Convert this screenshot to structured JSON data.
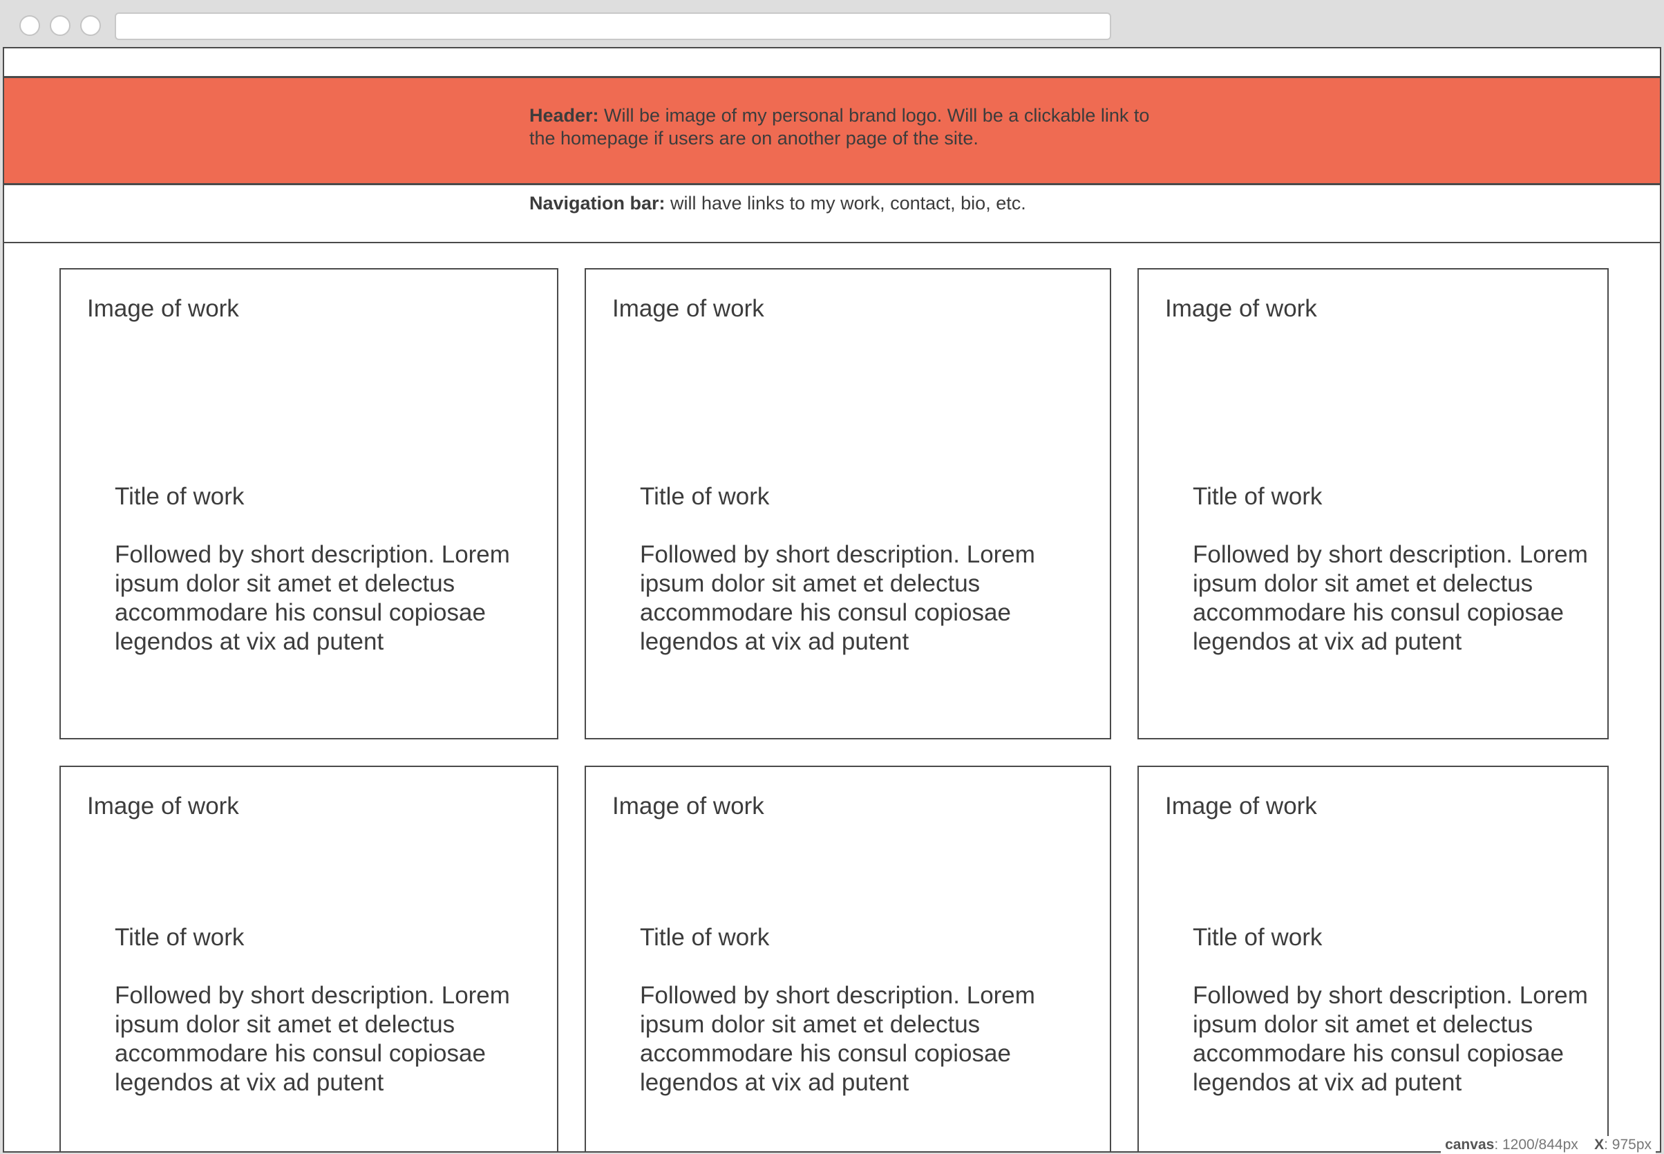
{
  "header": {
    "label": "Header:",
    "text": " Will be image of my personal brand logo. Will be a clickable link to the homepage if users are on another page of the site."
  },
  "nav": {
    "label": "Navigation bar:",
    "text": " will have links to my work, contact, bio, etc."
  },
  "cards": [
    {
      "image_label": "Image of work",
      "title": "Title of work",
      "description": "Followed by short description. Lorem ipsum dolor sit amet et delectus accommodare his consul copiosae legendos at vix ad putent"
    },
    {
      "image_label": "Image of work",
      "title": "Title of work",
      "description": "Followed by short description. Lorem ipsum dolor sit amet et delectus accommodare his consul copiosae legendos at vix ad putent"
    },
    {
      "image_label": "Image of work",
      "title": "Title of work",
      "description": "Followed by short description. Lorem ipsum dolor sit amet et delectus accommodare his consul copiosae legendos at vix ad putent"
    },
    {
      "image_label": "Image of work",
      "title": "Title of work",
      "description": "Followed by short description. Lorem ipsum dolor sit amet et delectus accommodare his consul copiosae legendos at vix ad putent"
    },
    {
      "image_label": "Image of work",
      "title": "Title of work",
      "description": "Followed by short description. Lorem ipsum dolor sit amet et delectus accommodare his consul copiosae legendos at vix ad putent"
    },
    {
      "image_label": "Image of work",
      "title": "Title of work",
      "description": "Followed by short description. Lorem ipsum dolor sit amet et delectus accommodare his consul copiosae legendos at vix ad putent"
    }
  ],
  "status": {
    "canvas_label": "canvas",
    "canvas_value": ": 1200/844px",
    "x_label": "X",
    "x_value": ": 975px"
  },
  "colors": {
    "header_bg": "#ef6b52",
    "border": "#4a4a4a",
    "text": "#3c3c3c",
    "chrome_bg": "#dedede"
  }
}
